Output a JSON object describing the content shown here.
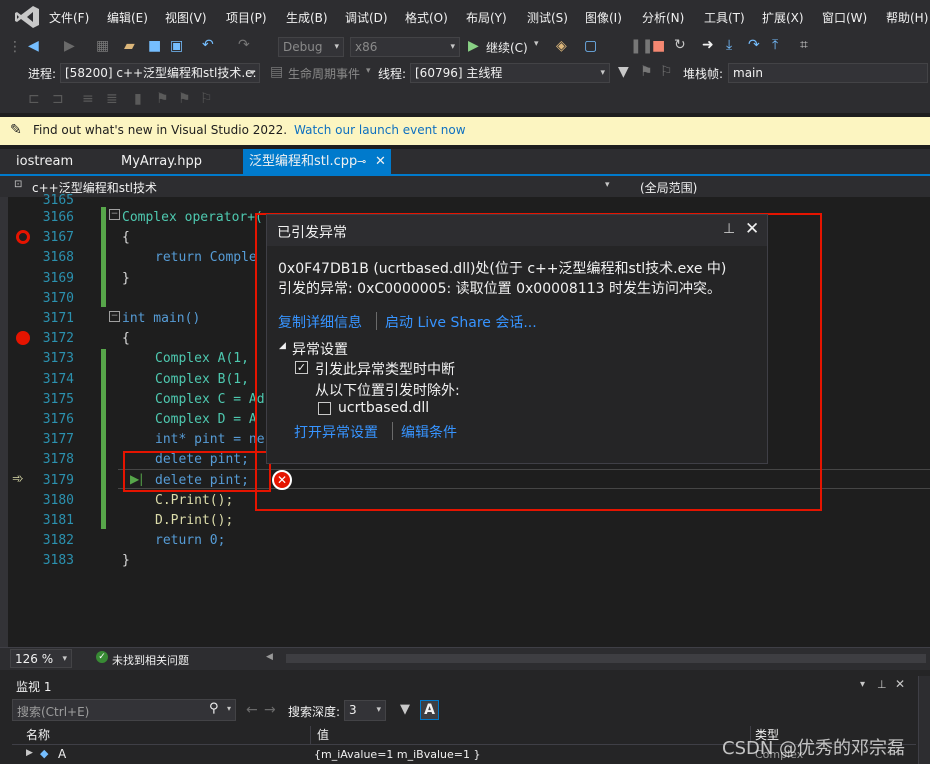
{
  "menu": [
    "文件(F)",
    "编辑(E)",
    "视图(V)",
    "项目(P)",
    "生成(B)",
    "调试(D)",
    "格式(O)",
    "布局(Y)",
    "测试(S)",
    "图像(I)",
    "分析(N)",
    "工具(T)",
    "扩展(X)",
    "窗口(W)",
    "帮助(H)"
  ],
  "toolbar1": {
    "config": "Debug",
    "platform": "x86",
    "continue_label": "继续(C)"
  },
  "toolbar2": {
    "process_label": "进程:",
    "process_value": "[58200] c++泛型编程和stl技术.e:",
    "lifecycle_label": "生命周期事件",
    "thread_label": "线程:",
    "thread_value": "[60796] 主线程",
    "stackframe_label": "堆栈帧:",
    "stackframe_value": "main"
  },
  "infobar": {
    "message": "Find out what's new in Visual Studio 2022.",
    "link": "Watch our launch event now"
  },
  "tabs": [
    {
      "label": "iostream"
    },
    {
      "label": "MyArray.hpp"
    },
    {
      "label": "泛型编程和stl.cpp"
    }
  ],
  "navbar": {
    "scope_left": "c++泛型编程和stl技术",
    "scope_right": "(全局范围)"
  },
  "editor": {
    "lines": [
      {
        "no": "3165",
        "text": ""
      },
      {
        "no": "3166",
        "text": "Complex operator+("
      },
      {
        "no": "3167",
        "text": "{"
      },
      {
        "no": "3168",
        "text": "return Comple"
      },
      {
        "no": "3169",
        "text": "}"
      },
      {
        "no": "3170",
        "text": ""
      },
      {
        "no": "3171",
        "text": "int main()"
      },
      {
        "no": "3172",
        "text": "{"
      },
      {
        "no": "3173",
        "text": "Complex A(1, "
      },
      {
        "no": "3174",
        "text": "Complex B(1, "
      },
      {
        "no": "3175",
        "text": "Complex C = Ad"
      },
      {
        "no": "3176",
        "text": "Complex D = A"
      },
      {
        "no": "3177",
        "text": "int* pint = ne"
      },
      {
        "no": "3178",
        "text": "delete pint;"
      },
      {
        "no": "3179",
        "text": "delete pint;"
      },
      {
        "no": "3180",
        "text": "C.Print();"
      },
      {
        "no": "3181",
        "text": "D.Print();"
      },
      {
        "no": "3182",
        "text": "return 0;"
      },
      {
        "no": "3183",
        "text": "}"
      }
    ]
  },
  "exception": {
    "title": "已引发异常",
    "line1": "0x0F47DB1B (ucrtbased.dll)处(位于 c++泛型编程和stl技术.exe 中)",
    "line2": "引发的异常: 0xC0000005: 读取位置 0x00008113 时发生访问冲突。",
    "link_copy": "复制详细信息",
    "link_share": "启动 Live Share 会话...",
    "section": "异常设置",
    "check1": "引发此异常类型时中断",
    "except_label": "从以下位置引发时除外:",
    "check2": "ucrtbased.dll",
    "link_open": "打开异常设置",
    "link_edit": "编辑条件"
  },
  "status": {
    "zoom": "126 %",
    "issues": "未找到相关问题"
  },
  "watch": {
    "title": "监视 1",
    "search_placeholder": "搜索(Ctrl+E)",
    "depth_label": "搜索深度:",
    "depth_value": "3",
    "col_name": "名称",
    "col_value": "值",
    "col_type": "类型",
    "row_name": "A",
    "row_value": "{m_iAvalue=1 m_iBvalue=1 }",
    "row_type": "Complex"
  },
  "watermark": "CSDN @优秀的邓宗磊",
  "colors": {
    "accent": "#007acc",
    "breakpoint": "#e51400",
    "infobar": "#fcf5c1",
    "link": "#3794ff"
  }
}
